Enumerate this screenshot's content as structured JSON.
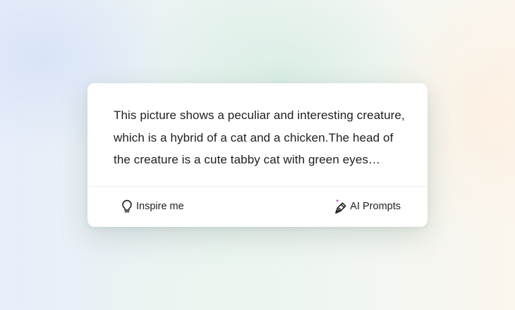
{
  "prompt": {
    "text": "This picture shows a peculiar and interesting creature, which is a hybrid of a cat and a chicken.The head of the creature is a cute tabby cat with green eyes…"
  },
  "actions": {
    "inspire_label": "Inspire me",
    "ai_prompts_label": "AI Prompts"
  },
  "icons": {
    "inspire": "lightbulb-icon",
    "ai_prompts": "pen-sparkle-icon"
  },
  "colors": {
    "text": "#1e1e22",
    "sparkle": "#c14fd8"
  }
}
